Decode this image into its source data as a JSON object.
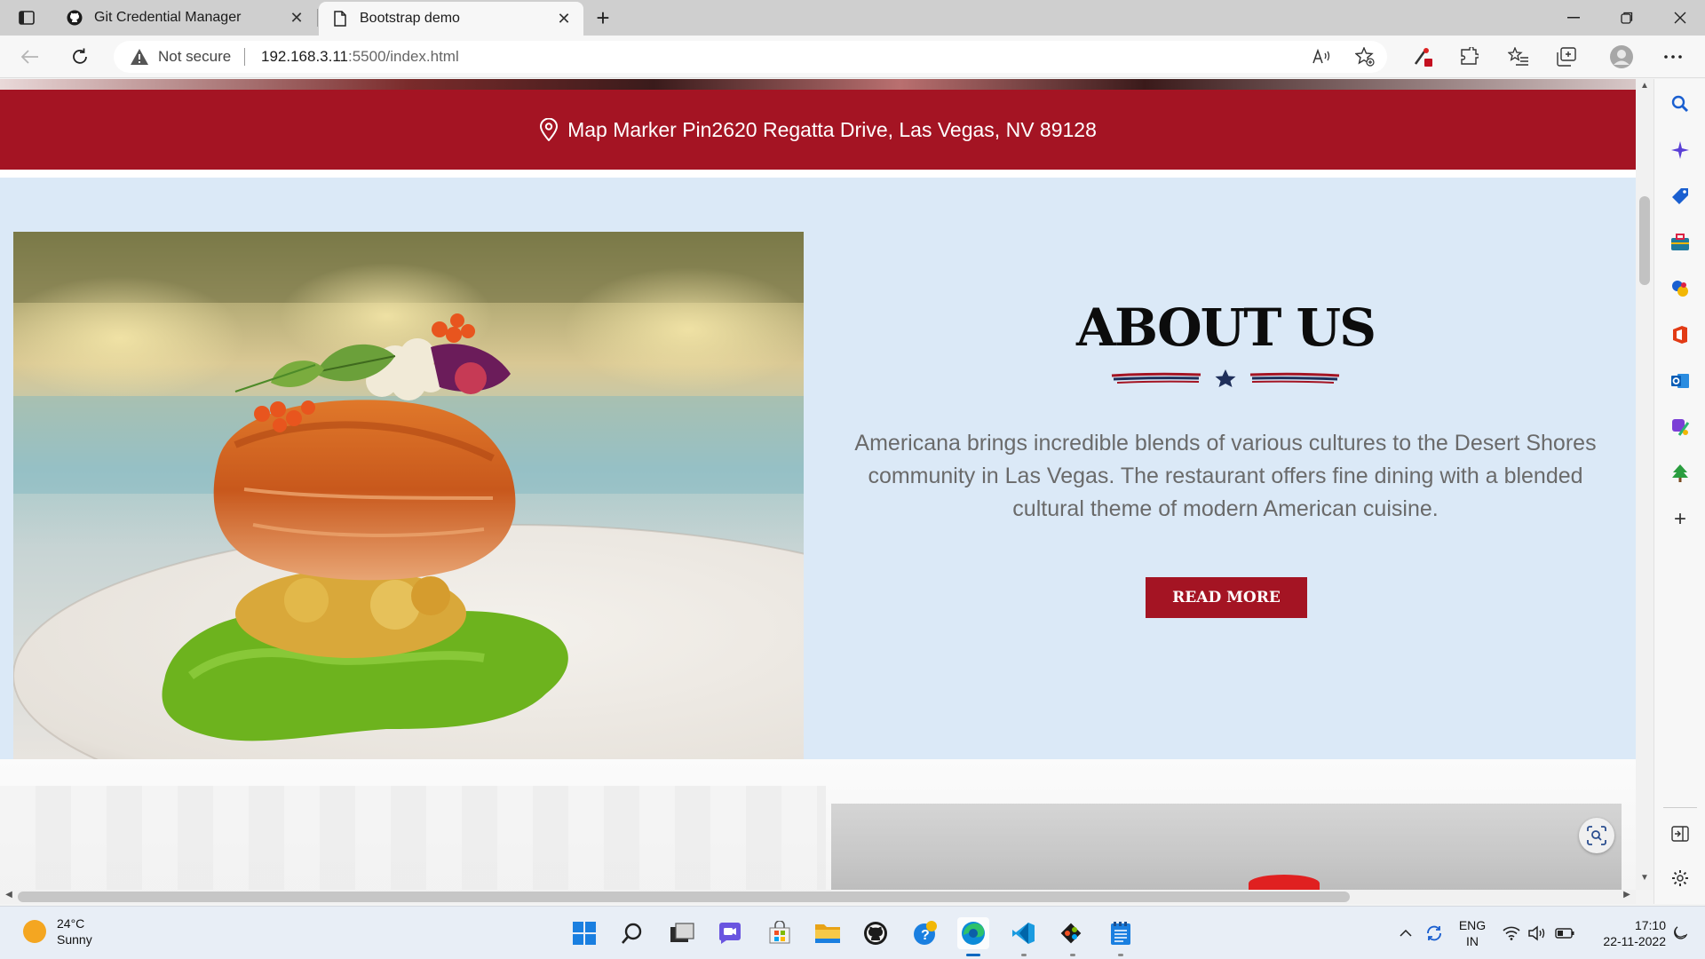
{
  "browser": {
    "tabs": [
      {
        "title": "Git Credential Manager",
        "icon": "github-icon",
        "active": false
      },
      {
        "title": "Bootstrap demo",
        "icon": "page-icon",
        "active": true
      }
    ],
    "address": {
      "security_label": "Not secure",
      "url_host": "192.168.3.11",
      "url_rest": ":5500/index.html"
    }
  },
  "page": {
    "address_banner": {
      "text": "Map Marker Pin2620 Regatta Drive, Las Vegas, NV 89128"
    },
    "about": {
      "heading": "ABOUT US",
      "body": "Americana brings incredible blends of various cultures to the Desert Shores community in Las Vegas. The restaurant offers fine dining with a blended cultural theme of modern American cuisine.",
      "button_label": "READ MORE"
    }
  },
  "taskbar": {
    "weather": {
      "temperature": "24°C",
      "condition": "Sunny"
    },
    "language": {
      "lang": "ENG",
      "region": "IN"
    },
    "clock": {
      "time": "17:10",
      "date": "22-11-2022"
    }
  },
  "colors": {
    "brand_red": "#a41423",
    "about_bg": "#dbe9f7",
    "accent_blue": "#0067c0"
  }
}
